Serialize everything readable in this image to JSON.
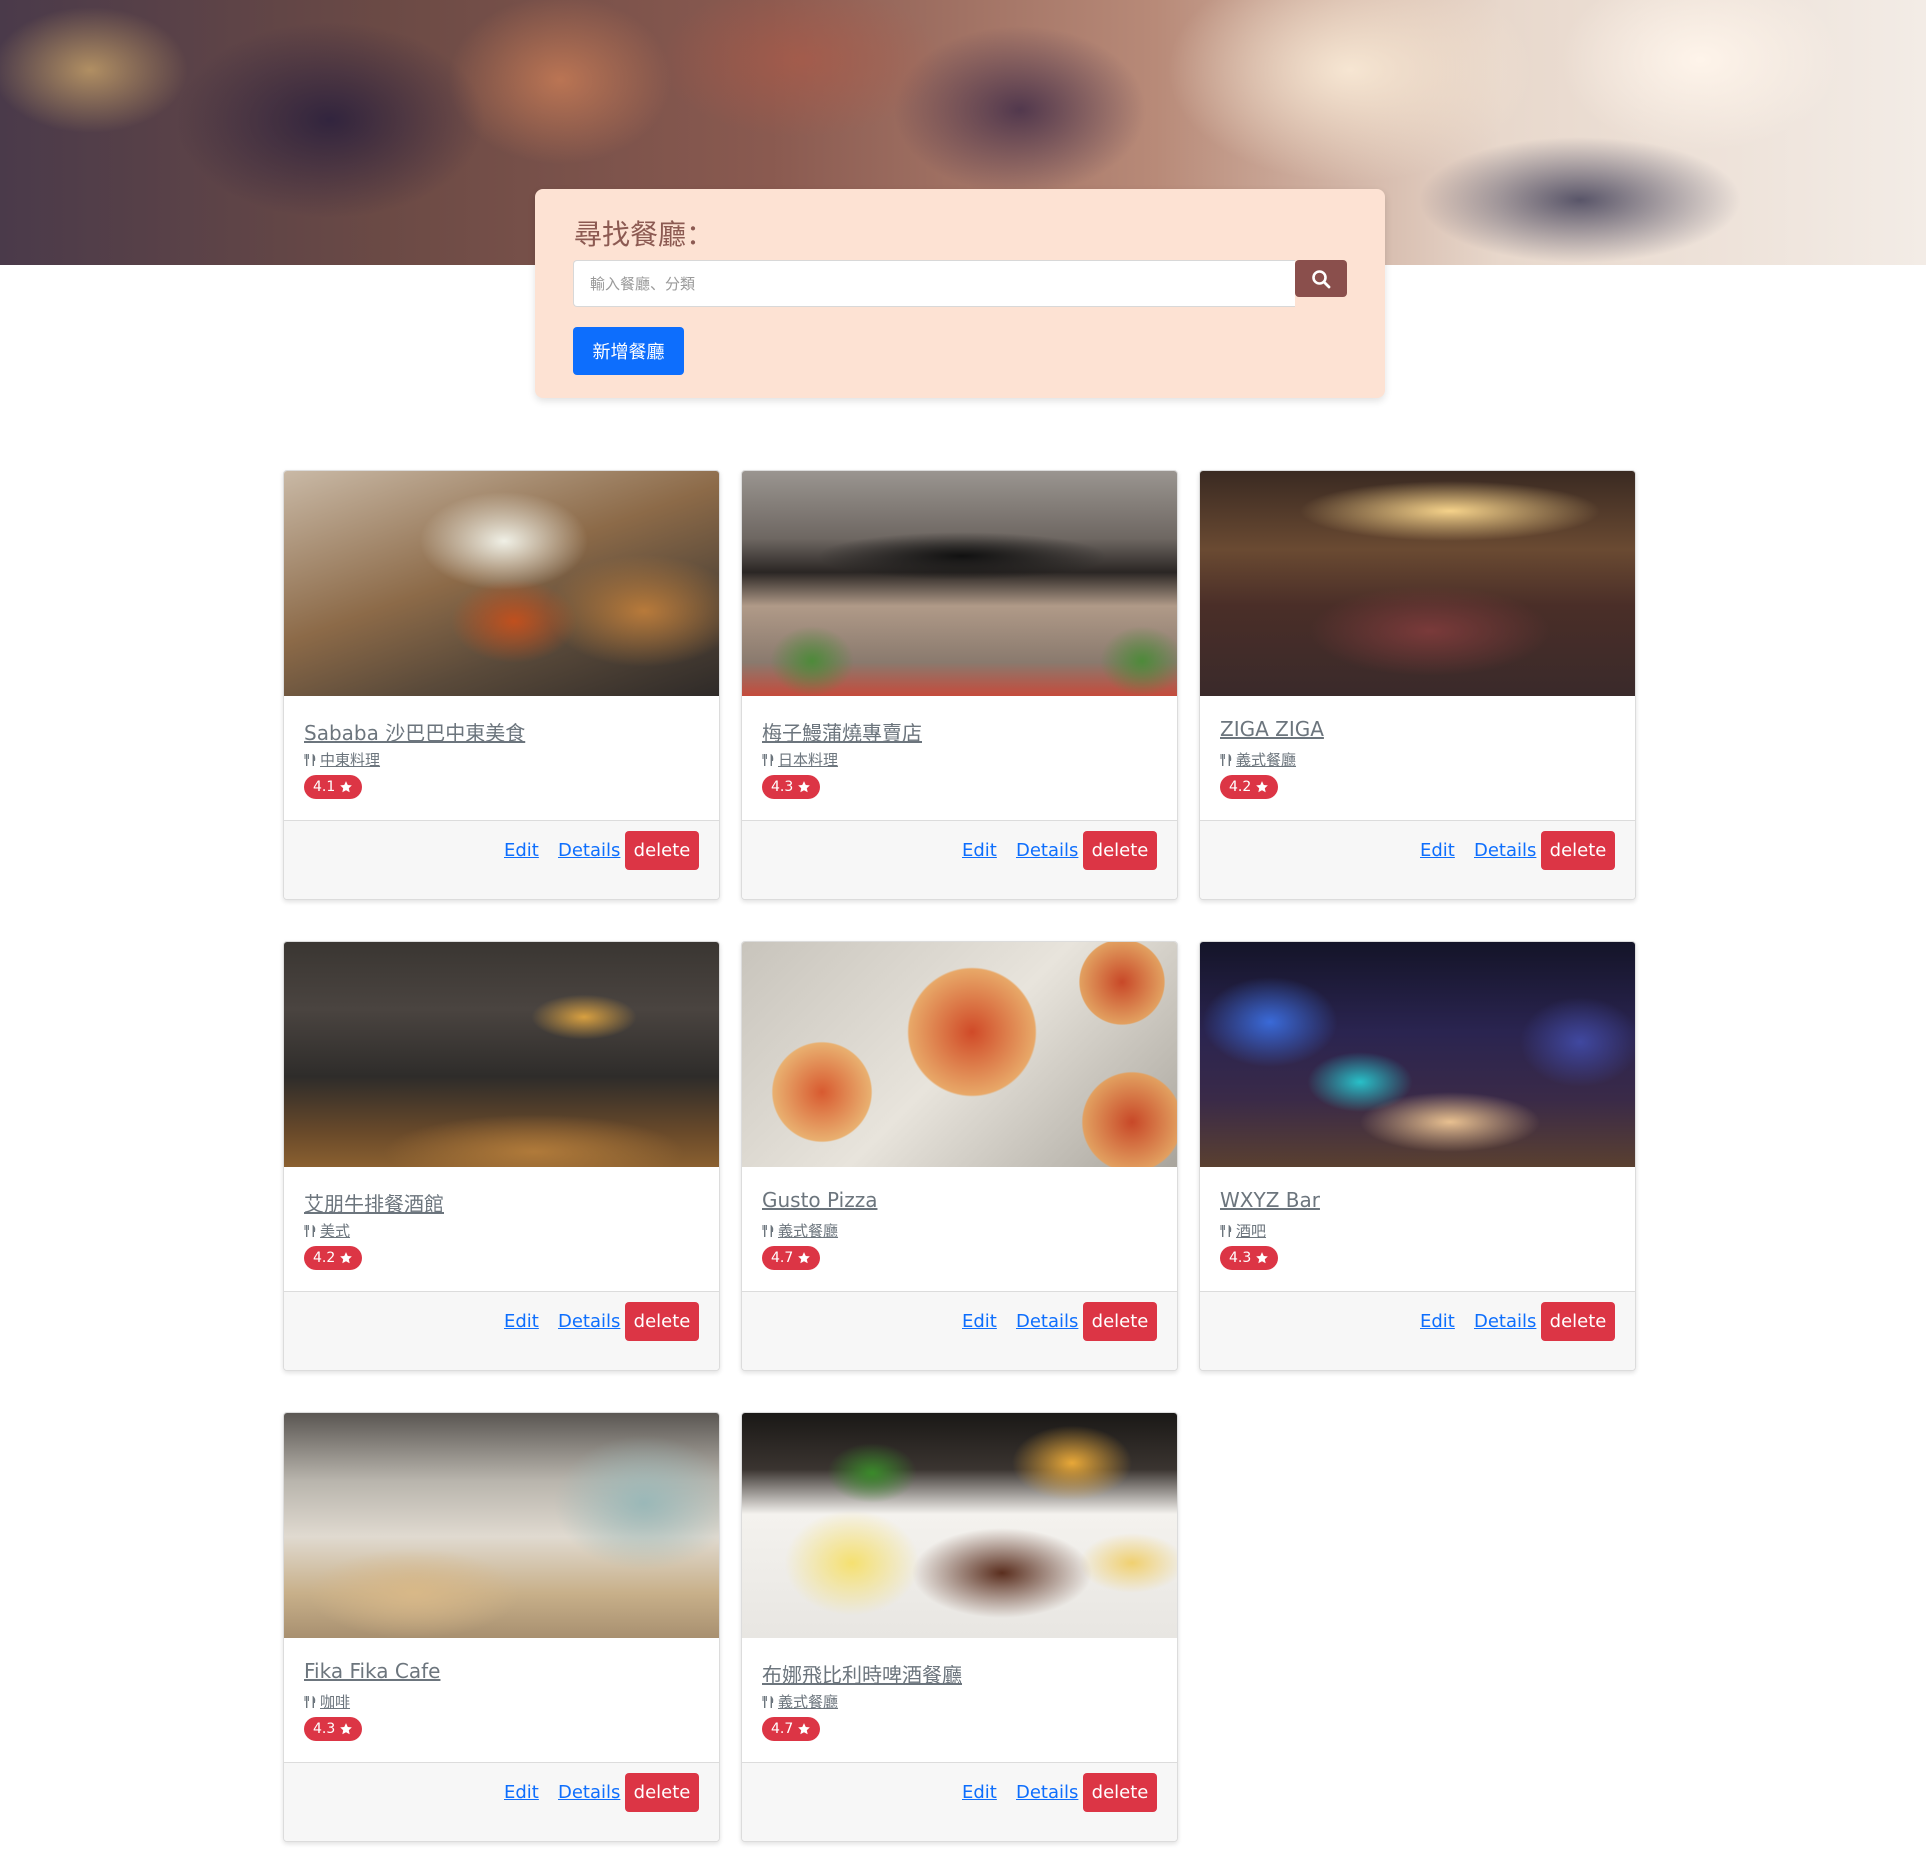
{
  "search": {
    "title": "尋找餐廳：",
    "placeholder": "輸入餐廳、分類",
    "add_button": "新增餐廳"
  },
  "restaurants": [
    {
      "name": "Sababa 沙巴巴中東美食",
      "category": "中東料理",
      "rating": "4.1",
      "edit": "Edit",
      "details": "Details",
      "delete": "delete"
    },
    {
      "name": "梅子鰻蒲燒專賣店",
      "category": "日本料理",
      "rating": "4.3",
      "edit": "Edit",
      "details": "Details",
      "delete": "delete"
    },
    {
      "name": "ZIGA ZIGA",
      "category": "義式餐廳",
      "rating": "4.2",
      "edit": "Edit",
      "details": "Details",
      "delete": "delete"
    },
    {
      "name": "艾朋牛排餐酒館",
      "category": "美式",
      "rating": "4.2",
      "edit": "Edit",
      "details": "Details",
      "delete": "delete"
    },
    {
      "name": "Gusto Pizza",
      "category": "義式餐廳",
      "rating": "4.7",
      "edit": "Edit",
      "details": "Details",
      "delete": "delete"
    },
    {
      "name": "WXYZ Bar",
      "category": "酒吧",
      "rating": "4.3",
      "edit": "Edit",
      "details": "Details",
      "delete": "delete"
    },
    {
      "name": "Fika Fika Cafe",
      "category": "咖啡",
      "rating": "4.3",
      "edit": "Edit",
      "details": "Details",
      "delete": "delete"
    },
    {
      "name": "布娜飛比利時啤酒餐廳",
      "category": "義式餐廳",
      "rating": "4.7",
      "edit": "Edit",
      "details": "Details",
      "delete": "delete"
    }
  ],
  "colors": {
    "panel_bg": "#fde2d3",
    "search_button": "#8a4f4c",
    "primary": "#0d6efd",
    "danger": "#dc3545"
  },
  "icons": {
    "search": "search-icon",
    "category": "utensils-icon",
    "rating": "star-icon"
  }
}
